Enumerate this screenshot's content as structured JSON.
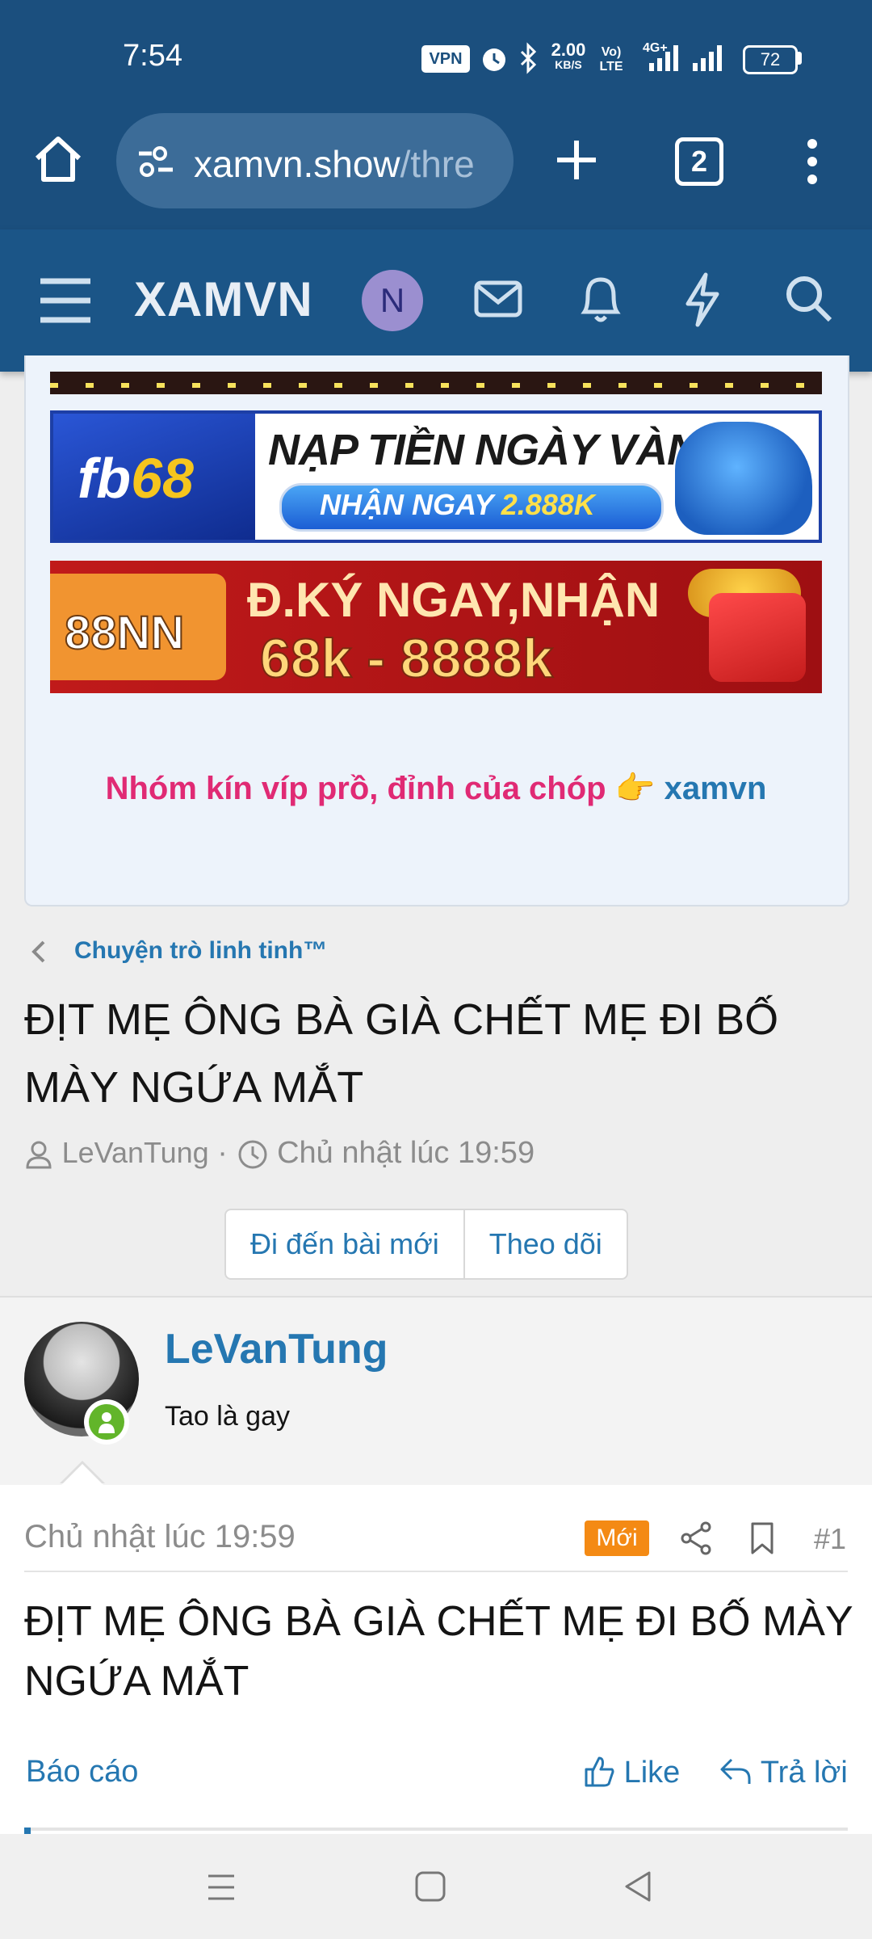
{
  "status_bar": {
    "time": "7:54",
    "vpn": "VPN",
    "net_speed": "2.00",
    "net_unit": "KB/S",
    "volte": "Vo) LTE",
    "network": "4G+",
    "battery": "72"
  },
  "browser": {
    "url_host": "xamvn.show",
    "url_path": "/thre",
    "tab_count": "2",
    "icons": [
      "home-icon",
      "site-settings-icon",
      "new-tab-icon",
      "tab-switcher-icon",
      "menu-icon"
    ]
  },
  "site_header": {
    "logo": "XAMVN",
    "avatar_letter": "N",
    "icons": [
      "hamburger-icon",
      "inbox-icon",
      "bell-icon",
      "whats-new-icon",
      "search-icon"
    ]
  },
  "promo": {
    "banner1": {
      "brand_part1": "fb",
      "brand_part2": "68",
      "title": "NẠP TIỀN NGÀY VÀNG",
      "pill_prefix": "NHẬN NGAY ",
      "pill_amount": "2.888K"
    },
    "banner2": {
      "brand": "88NN",
      "line1": "Đ.KÝ NGAY,NHẬN",
      "line2": "68k - 8888k"
    },
    "tagline_pink": "Nhóm kín víp prồ, đỉnh của chóp",
    "tagline_emoji": "👉",
    "tagline_link": "xamvn"
  },
  "thread": {
    "breadcrumb": "Chuyện trò linh tinh™",
    "title": "ĐỊT MẸ ÔNG BÀ GIÀ CHẾT MẸ ĐI BỐ MÀY NGỨA MẮT",
    "author": "LeVanTung",
    "separator": "·",
    "time": "Chủ nhật lúc 19:59",
    "btn_new_post": "Đi đến bài mới",
    "btn_follow": "Theo dõi"
  },
  "post": {
    "username": "LeVanTung",
    "user_title": "Tao là gay",
    "time": "Chủ nhật lúc 19:59",
    "badge": "Mới",
    "number": "#1",
    "body": "ĐỊT MẸ ÔNG BÀ GIÀ CHẾT MẸ ĐI BỐ MÀY NGỨA MẮT",
    "report": "Báo cáo",
    "like": "Like",
    "reply": "Trả lời"
  },
  "colors": {
    "brand_blue": "#1b5587",
    "link_blue": "#2577b1",
    "pink": "#e02a74",
    "new_badge": "#f48a14",
    "online_green": "#62b52a"
  }
}
